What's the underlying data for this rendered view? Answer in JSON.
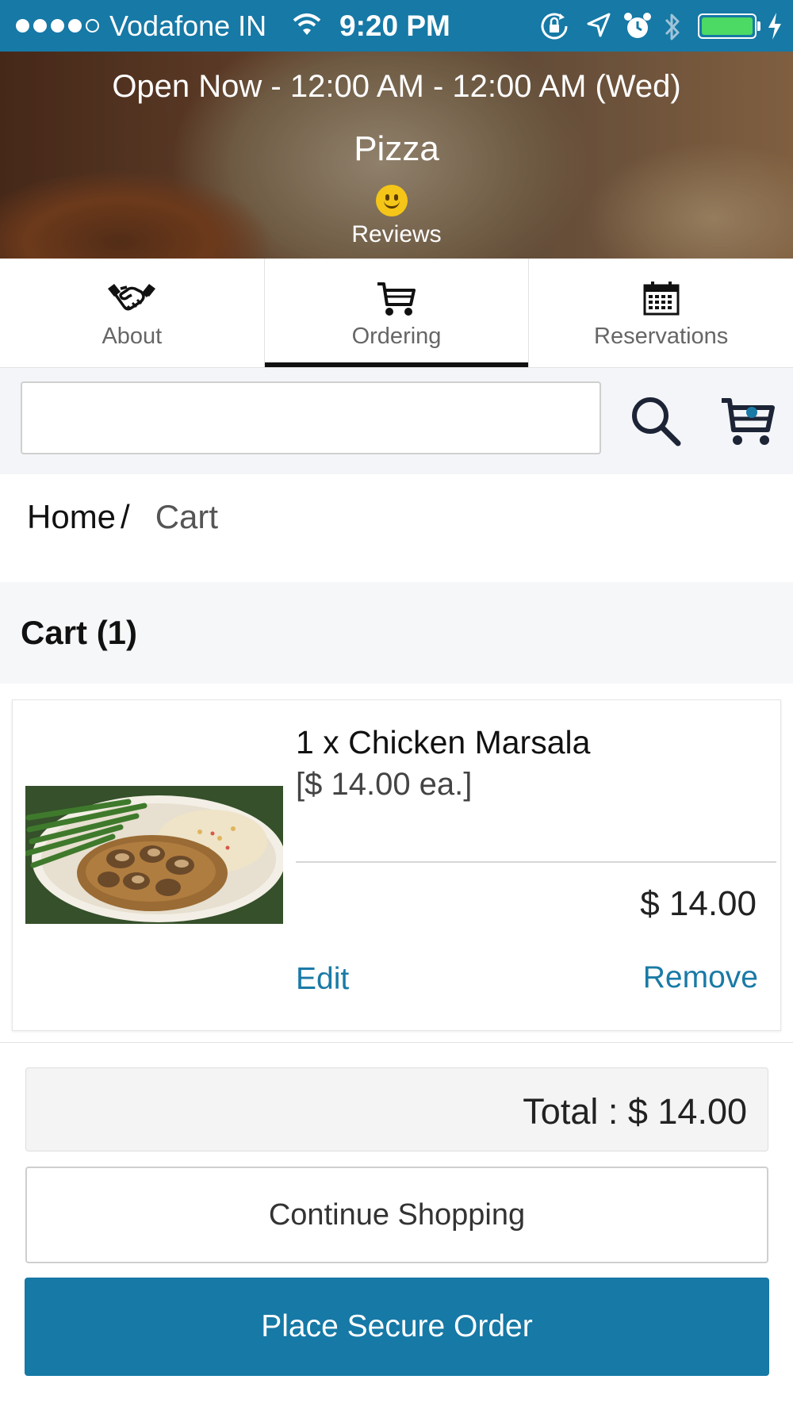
{
  "status_bar": {
    "carrier": "Vodafone IN",
    "time": "9:20 PM",
    "signal_bars_filled": 4,
    "signal_bars_total": 5,
    "icons": [
      "wifi-icon",
      "orientation-lock-icon",
      "location-icon",
      "alarm-icon",
      "bluetooth-icon",
      "battery-icon",
      "charging-icon"
    ],
    "battery_level": 1.0
  },
  "hero": {
    "hours": "Open Now - 12:00 AM - 12:00 AM (Wed)",
    "restaurant_name": "Pizza",
    "reviews_label": "Reviews"
  },
  "tabs": [
    {
      "label": "About",
      "icon": "handshake-icon",
      "active": false
    },
    {
      "label": "Ordering",
      "icon": "cart-icon",
      "active": true
    },
    {
      "label": "Reservations",
      "icon": "calendar-icon",
      "active": false
    }
  ],
  "search": {
    "value": "",
    "placeholder": ""
  },
  "breadcrumb": {
    "home": "Home",
    "separator": "/",
    "current": "Cart"
  },
  "cart": {
    "title": "Cart (1)",
    "items": [
      {
        "title": "1 x Chicken Marsala",
        "unit_price": "[$ 14.00 ea.]",
        "line_total": "$ 14.00",
        "edit_label": "Edit",
        "remove_label": "Remove"
      }
    ],
    "total": "Total : $ 14.00",
    "continue_label": "Continue Shopping",
    "order_label": "Place Secure Order"
  },
  "colors": {
    "brand": "#1679a6",
    "link": "#1a7aa6",
    "battery": "#4cd964"
  }
}
